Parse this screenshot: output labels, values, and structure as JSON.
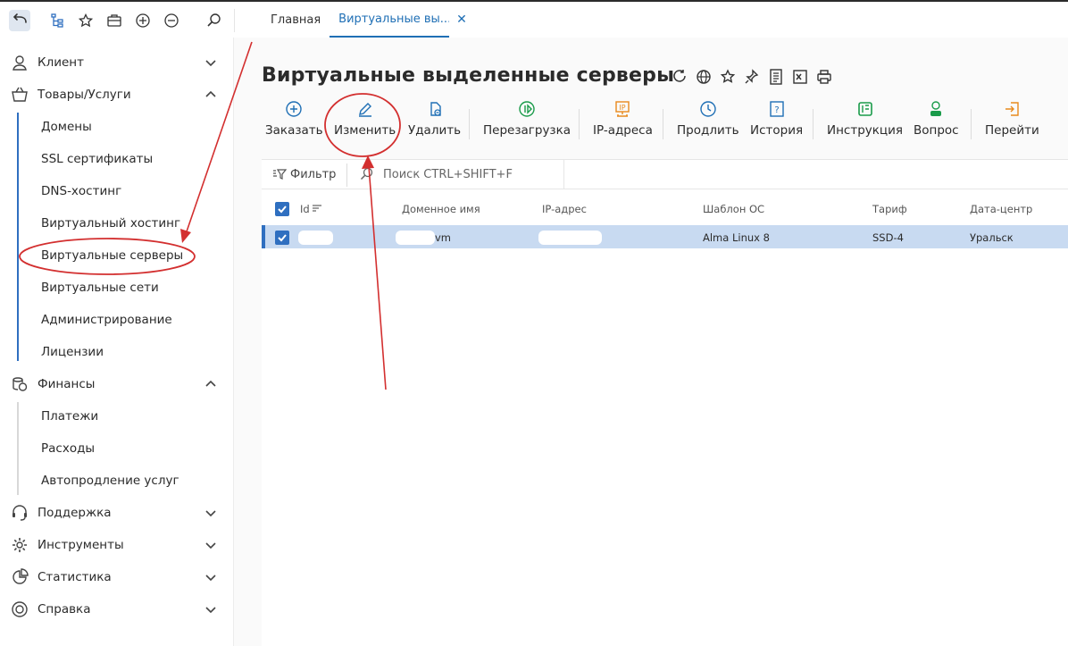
{
  "colors": {
    "accent": "#1f6fb5",
    "selected_row": "#c8daf1",
    "annotation": "#d32f2f"
  },
  "topbar": {
    "icons": [
      "back-arrow-icon",
      "tree-icon",
      "star-icon",
      "briefcase-icon",
      "plus-circle-icon",
      "minus-circle-icon",
      "search-icon"
    ],
    "tabs": [
      {
        "label": "Главная"
      },
      {
        "label": "Виртуальные вы..."
      }
    ]
  },
  "sidebar": {
    "groups": [
      {
        "label": "Клиент",
        "icon": "user-icon",
        "expanded": false
      },
      {
        "label": "Товары/Услуги",
        "icon": "basket-icon",
        "expanded": true,
        "items": [
          "Домены",
          "SSL сертификаты",
          "DNS-хостинг",
          "Виртуальный хостинг",
          "Виртуальные серверы",
          "Виртуальные сети",
          "Администрирование",
          "Лицензии"
        ]
      },
      {
        "label": "Финансы",
        "icon": "coins-icon",
        "expanded": true,
        "items": [
          "Платежи",
          "Расходы",
          "Автопродление услуг"
        ]
      },
      {
        "label": "Поддержка",
        "icon": "headset-icon",
        "expanded": false
      },
      {
        "label": "Инструменты",
        "icon": "gear-icon",
        "expanded": false
      },
      {
        "label": "Статистика",
        "icon": "chart-icon",
        "expanded": false
      },
      {
        "label": "Справка",
        "icon": "lifebuoy-icon",
        "expanded": false
      }
    ]
  },
  "page": {
    "title": "Виртуальные выделенные серверы",
    "title_icons": [
      "refresh-icon",
      "globe-icon",
      "star-icon",
      "pin-icon",
      "notes-icon",
      "excel-icon",
      "print-icon"
    ]
  },
  "toolbar": {
    "buttons": [
      {
        "label": "Заказать",
        "icon": "plus-circle-icon",
        "color": "#1f6fb5"
      },
      {
        "label": "Изменить",
        "icon": "pencil-icon",
        "color": "#1f6fb5"
      },
      {
        "label": "Удалить",
        "icon": "delete-doc-icon",
        "color": "#1f6fb5"
      },
      {
        "label": "Перезагрузка",
        "icon": "reboot-icon",
        "color": "#1a9b4a"
      },
      {
        "label": "IP-адреса",
        "icon": "ip-icon",
        "color": "#e8891c"
      },
      {
        "label": "Продлить",
        "icon": "clock-icon",
        "color": "#1f6fb5"
      },
      {
        "label": "История",
        "icon": "history-icon",
        "color": "#1f6fb5"
      },
      {
        "label": "Инструкция",
        "icon": "instruction-icon",
        "color": "#1a9b4a"
      },
      {
        "label": "Вопрос",
        "icon": "question-user-icon",
        "color": "#1a9b4a"
      },
      {
        "label": "Перейти",
        "icon": "go-icon",
        "color": "#e8891c"
      }
    ]
  },
  "filterbar": {
    "filter_label": "Фильтр",
    "search_placeholder": "Поиск CTRL+SHIFT+F"
  },
  "table": {
    "columns": [
      "Id",
      "Доменное имя",
      "IP-адрес",
      "Шаблон ОС",
      "Тариф",
      "Дата-центр"
    ],
    "rows": [
      {
        "id": "",
        "domain": "vm",
        "ip": "",
        "os": "Alma Linux 8",
        "tariff": "SSD-4",
        "dc": "Уральск",
        "selected": true
      }
    ]
  }
}
